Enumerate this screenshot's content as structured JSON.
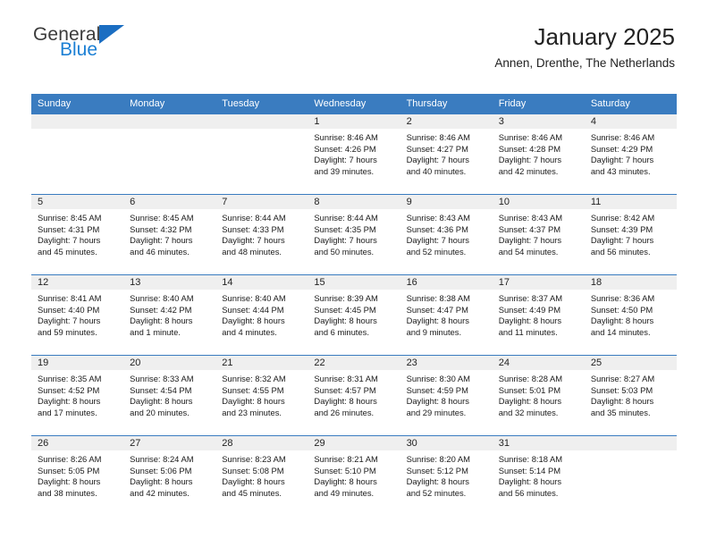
{
  "logo": {
    "word_one": "General",
    "word_two": "Blue",
    "triangle_icon": "triangle-icon",
    "accent_dark": "#3b3b3b",
    "accent_blue": "#1b7fd4"
  },
  "header": {
    "title": "January 2025",
    "subtitle": "Annen, Drenthe, The Netherlands"
  },
  "theme": {
    "header_blue": "#3a7cc0",
    "daynum_band": "#efefef",
    "text": "#1a1a1a"
  },
  "weekdays": [
    "Sunday",
    "Monday",
    "Tuesday",
    "Wednesday",
    "Thursday",
    "Friday",
    "Saturday"
  ],
  "weeks": [
    [
      {
        "day": ""
      },
      {
        "day": ""
      },
      {
        "day": ""
      },
      {
        "day": "1",
        "sunrise": "Sunrise: 8:46 AM",
        "sunset": "Sunset: 4:26 PM",
        "daylight_1": "Daylight: 7 hours",
        "daylight_2": "and 39 minutes."
      },
      {
        "day": "2",
        "sunrise": "Sunrise: 8:46 AM",
        "sunset": "Sunset: 4:27 PM",
        "daylight_1": "Daylight: 7 hours",
        "daylight_2": "and 40 minutes."
      },
      {
        "day": "3",
        "sunrise": "Sunrise: 8:46 AM",
        "sunset": "Sunset: 4:28 PM",
        "daylight_1": "Daylight: 7 hours",
        "daylight_2": "and 42 minutes."
      },
      {
        "day": "4",
        "sunrise": "Sunrise: 8:46 AM",
        "sunset": "Sunset: 4:29 PM",
        "daylight_1": "Daylight: 7 hours",
        "daylight_2": "and 43 minutes."
      }
    ],
    [
      {
        "day": "5",
        "sunrise": "Sunrise: 8:45 AM",
        "sunset": "Sunset: 4:31 PM",
        "daylight_1": "Daylight: 7 hours",
        "daylight_2": "and 45 minutes."
      },
      {
        "day": "6",
        "sunrise": "Sunrise: 8:45 AM",
        "sunset": "Sunset: 4:32 PM",
        "daylight_1": "Daylight: 7 hours",
        "daylight_2": "and 46 minutes."
      },
      {
        "day": "7",
        "sunrise": "Sunrise: 8:44 AM",
        "sunset": "Sunset: 4:33 PM",
        "daylight_1": "Daylight: 7 hours",
        "daylight_2": "and 48 minutes."
      },
      {
        "day": "8",
        "sunrise": "Sunrise: 8:44 AM",
        "sunset": "Sunset: 4:35 PM",
        "daylight_1": "Daylight: 7 hours",
        "daylight_2": "and 50 minutes."
      },
      {
        "day": "9",
        "sunrise": "Sunrise: 8:43 AM",
        "sunset": "Sunset: 4:36 PM",
        "daylight_1": "Daylight: 7 hours",
        "daylight_2": "and 52 minutes."
      },
      {
        "day": "10",
        "sunrise": "Sunrise: 8:43 AM",
        "sunset": "Sunset: 4:37 PM",
        "daylight_1": "Daylight: 7 hours",
        "daylight_2": "and 54 minutes."
      },
      {
        "day": "11",
        "sunrise": "Sunrise: 8:42 AM",
        "sunset": "Sunset: 4:39 PM",
        "daylight_1": "Daylight: 7 hours",
        "daylight_2": "and 56 minutes."
      }
    ],
    [
      {
        "day": "12",
        "sunrise": "Sunrise: 8:41 AM",
        "sunset": "Sunset: 4:40 PM",
        "daylight_1": "Daylight: 7 hours",
        "daylight_2": "and 59 minutes."
      },
      {
        "day": "13",
        "sunrise": "Sunrise: 8:40 AM",
        "sunset": "Sunset: 4:42 PM",
        "daylight_1": "Daylight: 8 hours",
        "daylight_2": "and 1 minute."
      },
      {
        "day": "14",
        "sunrise": "Sunrise: 8:40 AM",
        "sunset": "Sunset: 4:44 PM",
        "daylight_1": "Daylight: 8 hours",
        "daylight_2": "and 4 minutes."
      },
      {
        "day": "15",
        "sunrise": "Sunrise: 8:39 AM",
        "sunset": "Sunset: 4:45 PM",
        "daylight_1": "Daylight: 8 hours",
        "daylight_2": "and 6 minutes."
      },
      {
        "day": "16",
        "sunrise": "Sunrise: 8:38 AM",
        "sunset": "Sunset: 4:47 PM",
        "daylight_1": "Daylight: 8 hours",
        "daylight_2": "and 9 minutes."
      },
      {
        "day": "17",
        "sunrise": "Sunrise: 8:37 AM",
        "sunset": "Sunset: 4:49 PM",
        "daylight_1": "Daylight: 8 hours",
        "daylight_2": "and 11 minutes."
      },
      {
        "day": "18",
        "sunrise": "Sunrise: 8:36 AM",
        "sunset": "Sunset: 4:50 PM",
        "daylight_1": "Daylight: 8 hours",
        "daylight_2": "and 14 minutes."
      }
    ],
    [
      {
        "day": "19",
        "sunrise": "Sunrise: 8:35 AM",
        "sunset": "Sunset: 4:52 PM",
        "daylight_1": "Daylight: 8 hours",
        "daylight_2": "and 17 minutes."
      },
      {
        "day": "20",
        "sunrise": "Sunrise: 8:33 AM",
        "sunset": "Sunset: 4:54 PM",
        "daylight_1": "Daylight: 8 hours",
        "daylight_2": "and 20 minutes."
      },
      {
        "day": "21",
        "sunrise": "Sunrise: 8:32 AM",
        "sunset": "Sunset: 4:55 PM",
        "daylight_1": "Daylight: 8 hours",
        "daylight_2": "and 23 minutes."
      },
      {
        "day": "22",
        "sunrise": "Sunrise: 8:31 AM",
        "sunset": "Sunset: 4:57 PM",
        "daylight_1": "Daylight: 8 hours",
        "daylight_2": "and 26 minutes."
      },
      {
        "day": "23",
        "sunrise": "Sunrise: 8:30 AM",
        "sunset": "Sunset: 4:59 PM",
        "daylight_1": "Daylight: 8 hours",
        "daylight_2": "and 29 minutes."
      },
      {
        "day": "24",
        "sunrise": "Sunrise: 8:28 AM",
        "sunset": "Sunset: 5:01 PM",
        "daylight_1": "Daylight: 8 hours",
        "daylight_2": "and 32 minutes."
      },
      {
        "day": "25",
        "sunrise": "Sunrise: 8:27 AM",
        "sunset": "Sunset: 5:03 PM",
        "daylight_1": "Daylight: 8 hours",
        "daylight_2": "and 35 minutes."
      }
    ],
    [
      {
        "day": "26",
        "sunrise": "Sunrise: 8:26 AM",
        "sunset": "Sunset: 5:05 PM",
        "daylight_1": "Daylight: 8 hours",
        "daylight_2": "and 38 minutes."
      },
      {
        "day": "27",
        "sunrise": "Sunrise: 8:24 AM",
        "sunset": "Sunset: 5:06 PM",
        "daylight_1": "Daylight: 8 hours",
        "daylight_2": "and 42 minutes."
      },
      {
        "day": "28",
        "sunrise": "Sunrise: 8:23 AM",
        "sunset": "Sunset: 5:08 PM",
        "daylight_1": "Daylight: 8 hours",
        "daylight_2": "and 45 minutes."
      },
      {
        "day": "29",
        "sunrise": "Sunrise: 8:21 AM",
        "sunset": "Sunset: 5:10 PM",
        "daylight_1": "Daylight: 8 hours",
        "daylight_2": "and 49 minutes."
      },
      {
        "day": "30",
        "sunrise": "Sunrise: 8:20 AM",
        "sunset": "Sunset: 5:12 PM",
        "daylight_1": "Daylight: 8 hours",
        "daylight_2": "and 52 minutes."
      },
      {
        "day": "31",
        "sunrise": "Sunrise: 8:18 AM",
        "sunset": "Sunset: 5:14 PM",
        "daylight_1": "Daylight: 8 hours",
        "daylight_2": "and 56 minutes."
      },
      {
        "day": ""
      }
    ]
  ]
}
